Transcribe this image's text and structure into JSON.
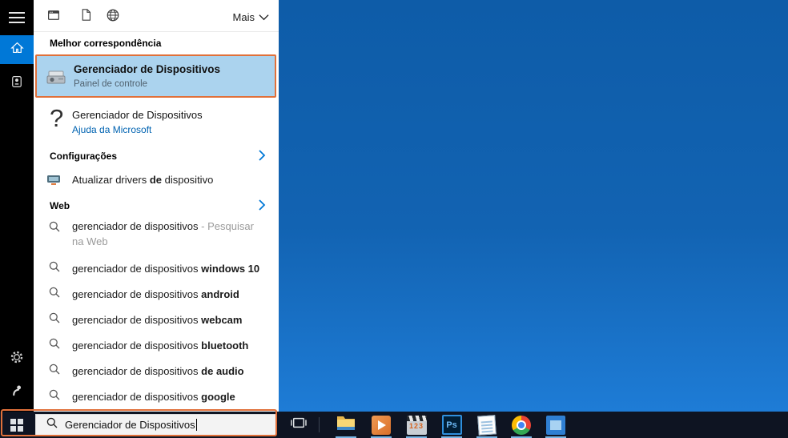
{
  "colors": {
    "accent_blue": "#0078d7",
    "highlight_orange": "#e0703a",
    "best_match_selection": "#abd3ee",
    "desktop_blue": "#1263b2",
    "taskbar_dark": "#0e1422",
    "link_blue": "#0063b1"
  },
  "sidebar": {
    "items": [
      {
        "name": "menu",
        "icon": "hamburger-icon"
      },
      {
        "name": "home",
        "icon": "home-icon",
        "selected": true
      },
      {
        "name": "notebook",
        "icon": "notebook-icon"
      },
      {
        "name": "settings",
        "icon": "gear-icon"
      },
      {
        "name": "feedback",
        "icon": "feedback-icon"
      }
    ]
  },
  "search_panel": {
    "filters": {
      "icons": [
        "apps-icon",
        "document-icon",
        "globe-icon"
      ],
      "more_label": "Mais",
      "more_icon": "chevron-down-icon"
    },
    "best_match": {
      "header": "Melhor correspondência",
      "title": "Gerenciador de Dispositivos",
      "subtitle": "Painel de controle",
      "icon": "device-manager-icon",
      "highlighted": true
    },
    "help_result": {
      "icon": "?",
      "title": "Gerenciador de Dispositivos",
      "subtitle": "Ajuda da Microsoft"
    },
    "settings": {
      "header": "Configurações",
      "chevron_icon": "chevron-right-icon",
      "item": {
        "pre": "Atualizar drivers ",
        "bold": "de",
        "post": " dispositivo",
        "icon": "driver-update-icon"
      }
    },
    "web": {
      "header": "Web",
      "chevron_icon": "chevron-right-icon",
      "suggestions": [
        {
          "plain": "gerenciador de dispositivos",
          "annotation": " - Pesquisar na Web"
        },
        {
          "plain": "gerenciador de dispositivos ",
          "bold": "windows 10"
        },
        {
          "plain": "gerenciador de dispositivos ",
          "bold": "android"
        },
        {
          "plain": "gerenciador de dispositivos ",
          "bold": "webcam"
        },
        {
          "plain": "gerenciador de dispositivos ",
          "bold": "bluetooth"
        },
        {
          "plain": "gerenciador de dispositivos ",
          "bold": "de audio"
        },
        {
          "plain": "gerenciador de dispositivos ",
          "bold": "google"
        }
      ]
    }
  },
  "taskbar": {
    "start": {
      "icon": "windows-logo-icon"
    },
    "search": {
      "value": "Gerenciador de Dispositivos",
      "icon": "search-icon",
      "highlighted": true
    },
    "taskview_icon": "task-view-icon",
    "apps": [
      {
        "name": "file-explorer",
        "running": true
      },
      {
        "name": "media-player-classic",
        "running": true
      },
      {
        "name": "klite-codec",
        "running": true
      },
      {
        "name": "photoshop",
        "running": true
      },
      {
        "name": "notepad",
        "running": true
      },
      {
        "name": "chrome",
        "running": true
      },
      {
        "name": "photos",
        "running": true
      }
    ]
  }
}
